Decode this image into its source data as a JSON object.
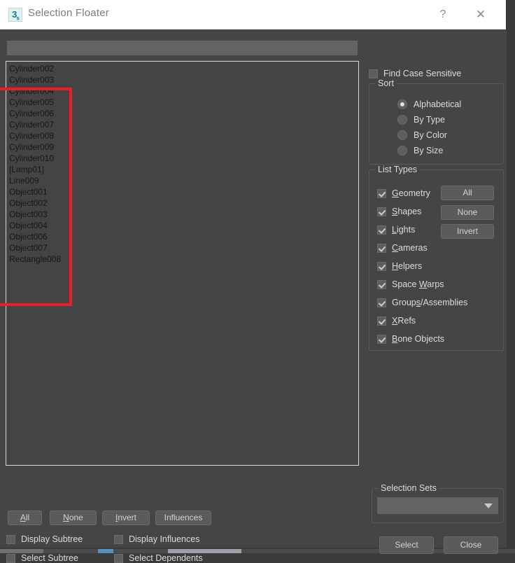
{
  "window": {
    "title": "Selection Floater",
    "icon": "max-3ds-icon",
    "help_label": "?",
    "close_label": "✕"
  },
  "search": {
    "value": "",
    "placeholder": ""
  },
  "object_list": [
    "Cylinder002",
    "Cylinder003",
    "Cylinder004",
    "Cylinder005",
    "Cylinder006",
    "Cylinder007",
    "Cylinder008",
    "Cylinder009",
    "Cylinder010",
    "[Lamp01]",
    "Line009",
    "Object001",
    "Object002",
    "Object003",
    "Object004",
    "Object006",
    "Object007",
    "Rectangle008"
  ],
  "annotation": {
    "color": "#ee1c24",
    "target": "object-list"
  },
  "find_case_sensitive": {
    "label": "Find Case Sensitive",
    "checked": false
  },
  "sort": {
    "legend": "Sort",
    "options": [
      {
        "label": "Alphabetical",
        "selected": true
      },
      {
        "label": "By Type",
        "selected": false
      },
      {
        "label": "By Color",
        "selected": false
      },
      {
        "label": "By Size",
        "selected": false
      }
    ]
  },
  "list_types": {
    "legend": "List Types",
    "items": [
      {
        "label": "Geometry",
        "mnemonic": "G",
        "checked": true
      },
      {
        "label": "Shapes",
        "mnemonic": "S",
        "checked": true
      },
      {
        "label": "Lights",
        "mnemonic": "L",
        "checked": true
      },
      {
        "label": "Cameras",
        "mnemonic": "C",
        "checked": true
      },
      {
        "label": "Helpers",
        "mnemonic": "H",
        "checked": true
      },
      {
        "label": "Space Warps",
        "mnemonic": "W",
        "checked": true
      },
      {
        "label": "Groups/Assemblies",
        "mnemonic": "s",
        "checked": true
      },
      {
        "label": "XRefs",
        "mnemonic": "X",
        "checked": true
      },
      {
        "label": "Bone Objects",
        "mnemonic": "B",
        "checked": true
      }
    ],
    "buttons": [
      {
        "label": "All"
      },
      {
        "label": "None"
      },
      {
        "label": "Invert"
      }
    ]
  },
  "selection_buttons": [
    {
      "label": "All",
      "mnemonic": "A"
    },
    {
      "label": "None",
      "mnemonic": "N"
    },
    {
      "label": "Invert",
      "mnemonic": "I"
    },
    {
      "label": "Influences",
      "mnemonic": ""
    }
  ],
  "options": [
    {
      "label": "Display Subtree",
      "checked": false
    },
    {
      "label": "Select Subtree",
      "checked": false
    },
    {
      "label": "Display Influences",
      "checked": false
    },
    {
      "label": "Select Dependents",
      "checked": false
    }
  ],
  "selection_sets": {
    "legend": "Selection Sets",
    "value": "",
    "arrow": "chevron-down-icon"
  },
  "footer": {
    "select_label": "Select",
    "close_label": "Close"
  }
}
